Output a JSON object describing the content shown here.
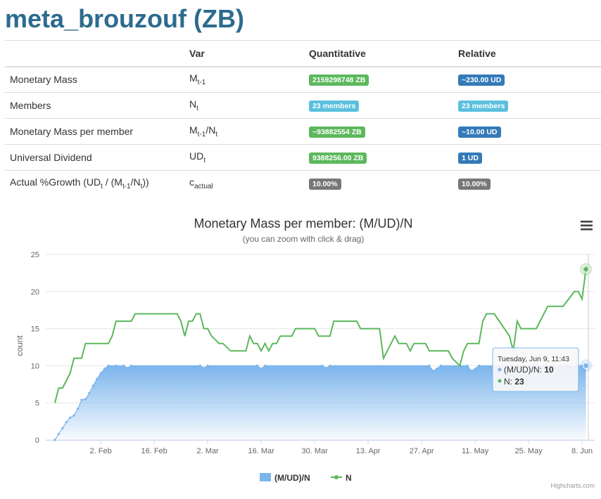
{
  "page_title": "meta_brouzouf (ZB)",
  "table": {
    "headers": [
      "",
      "Var",
      "Quantitative",
      "Relative"
    ],
    "rows": [
      {
        "label": "Monetary Mass",
        "var_base": "M",
        "var_sub": "t-1",
        "var_mid": "",
        "var_sub2": "",
        "quant": "2159298748 ZB",
        "quant_color": "#5cb85c",
        "rel": "~230.00 UD",
        "rel_color": "#337ab7"
      },
      {
        "label": "Members",
        "var_base": "N",
        "var_sub": "t",
        "var_mid": "",
        "var_sub2": "",
        "quant": "23 members",
        "quant_color": "#5bc0de",
        "rel": "23 members",
        "rel_color": "#5bc0de"
      },
      {
        "label": "Monetary Mass per member",
        "var_base": "M",
        "var_sub": "t-1",
        "var_mid": "/N",
        "var_sub2": "t",
        "quant": "~93882554 ZB",
        "quant_color": "#5cb85c",
        "rel": "~10.00 UD",
        "rel_color": "#337ab7"
      },
      {
        "label": "Universal Dividend",
        "var_base": "UD",
        "var_sub": "t",
        "var_mid": "",
        "var_sub2": "",
        "quant": "9388256.00 ZB",
        "quant_color": "#5cb85c",
        "rel": "1 UD",
        "rel_color": "#337ab7"
      },
      {
        "label_parts": [
          "Actual %Growth (UD",
          "t",
          " / (M",
          "t-1",
          "/N",
          "t",
          "))"
        ],
        "var_base": "c",
        "var_sub": "actual",
        "var_mid": "",
        "var_sub2": "",
        "quant": "10.00%",
        "quant_color": "#777777",
        "rel": "10.00%",
        "rel_color": "#777777"
      }
    ]
  },
  "chart_data": {
    "type": "area",
    "title": "Monetary Mass per member: (M/UD)/N",
    "subtitle": "(you can zoom with click & drag)",
    "ylabel": "count",
    "xlabel": "",
    "ylim": [
      0,
      25
    ],
    "yticks": [
      "0",
      "5",
      "10",
      "15",
      "20",
      "25"
    ],
    "xlim": [
      "2015-01-21",
      "2015-06-10"
    ],
    "xticks": [
      {
        "date": "2015-02-02",
        "label": "2. Feb"
      },
      {
        "date": "2015-02-16",
        "label": "16. Feb"
      },
      {
        "date": "2015-03-02",
        "label": "2. Mar"
      },
      {
        "date": "2015-03-16",
        "label": "16. Mar"
      },
      {
        "date": "2015-03-30",
        "label": "30. Mar"
      },
      {
        "date": "2015-04-13",
        "label": "13. Apr"
      },
      {
        "date": "2015-04-27",
        "label": "27. Apr"
      },
      {
        "date": "2015-05-11",
        "label": "11. May"
      },
      {
        "date": "2015-05-25",
        "label": "25. May"
      },
      {
        "date": "2015-06-08",
        "label": "8. Jun"
      }
    ],
    "grid": true,
    "legend_position": "bottom-center",
    "series": [
      {
        "name": "(M/UD)/N",
        "color": "#7cb5ec",
        "kind": "area",
        "points": [
          [
            "2015-01-21",
            0
          ],
          [
            "2015-01-22",
            0.8
          ],
          [
            "2015-01-23",
            1.6
          ],
          [
            "2015-01-24",
            2.4
          ],
          [
            "2015-01-25",
            3.0
          ],
          [
            "2015-01-26",
            3.3
          ],
          [
            "2015-01-27",
            4.2
          ],
          [
            "2015-01-28",
            5.4
          ],
          [
            "2015-01-29",
            5.5
          ],
          [
            "2015-01-30",
            6.3
          ],
          [
            "2015-01-31",
            7.3
          ],
          [
            "2015-02-01",
            8.2
          ],
          [
            "2015-02-02",
            9.0
          ],
          [
            "2015-02-03",
            9.6
          ],
          [
            "2015-02-04",
            10
          ],
          [
            "2015-02-06",
            10
          ],
          [
            "2015-02-08",
            10
          ],
          [
            "2015-02-09",
            9.7
          ],
          [
            "2015-02-10",
            10
          ],
          [
            "2015-02-28",
            10
          ],
          [
            "2015-03-01",
            9.7
          ],
          [
            "2015-03-02",
            10
          ],
          [
            "2015-03-15",
            10
          ],
          [
            "2015-03-16",
            9.6
          ],
          [
            "2015-03-17",
            10
          ],
          [
            "2015-04-01",
            10
          ],
          [
            "2015-04-02",
            9.7
          ],
          [
            "2015-04-03",
            10
          ],
          [
            "2015-04-29",
            10
          ],
          [
            "2015-04-30",
            9.3
          ],
          [
            "2015-05-01",
            9.6
          ],
          [
            "2015-05-02",
            10
          ],
          [
            "2015-05-09",
            10
          ],
          [
            "2015-05-10",
            9.3
          ],
          [
            "2015-05-11",
            9.6
          ],
          [
            "2015-05-12",
            10
          ],
          [
            "2015-06-08",
            10
          ],
          [
            "2015-06-09",
            10
          ]
        ]
      },
      {
        "name": "N",
        "color": "#5cb85c",
        "kind": "line",
        "points": [
          [
            "2015-01-21",
            5
          ],
          [
            "2015-01-22",
            7
          ],
          [
            "2015-01-23",
            7
          ],
          [
            "2015-01-25",
            9
          ],
          [
            "2015-01-26",
            11
          ],
          [
            "2015-01-28",
            11
          ],
          [
            "2015-01-29",
            13
          ],
          [
            "2015-02-04",
            13
          ],
          [
            "2015-02-05",
            14
          ],
          [
            "2015-02-06",
            16
          ],
          [
            "2015-02-10",
            16
          ],
          [
            "2015-02-11",
            17
          ],
          [
            "2015-02-22",
            17
          ],
          [
            "2015-02-23",
            16
          ],
          [
            "2015-02-24",
            14
          ],
          [
            "2015-02-25",
            16
          ],
          [
            "2015-02-26",
            16
          ],
          [
            "2015-02-27",
            17
          ],
          [
            "2015-02-28",
            17
          ],
          [
            "2015-03-01",
            15
          ],
          [
            "2015-03-02",
            15
          ],
          [
            "2015-03-03",
            14
          ],
          [
            "2015-03-05",
            13
          ],
          [
            "2015-03-06",
            13
          ],
          [
            "2015-03-08",
            12
          ],
          [
            "2015-03-12",
            12
          ],
          [
            "2015-03-13",
            14
          ],
          [
            "2015-03-14",
            13
          ],
          [
            "2015-03-15",
            13
          ],
          [
            "2015-03-16",
            12
          ],
          [
            "2015-03-17",
            13
          ],
          [
            "2015-03-18",
            12
          ],
          [
            "2015-03-19",
            13
          ],
          [
            "2015-03-20",
            13
          ],
          [
            "2015-03-21",
            14
          ],
          [
            "2015-03-24",
            14
          ],
          [
            "2015-03-25",
            15
          ],
          [
            "2015-03-30",
            15
          ],
          [
            "2015-03-31",
            14
          ],
          [
            "2015-04-03",
            14
          ],
          [
            "2015-04-04",
            16
          ],
          [
            "2015-04-10",
            16
          ],
          [
            "2015-04-11",
            15
          ],
          [
            "2015-04-16",
            15
          ],
          [
            "2015-04-17",
            11
          ],
          [
            "2015-04-20",
            14
          ],
          [
            "2015-04-21",
            13
          ],
          [
            "2015-04-23",
            13
          ],
          [
            "2015-04-24",
            12
          ],
          [
            "2015-04-25",
            13
          ],
          [
            "2015-04-28",
            13
          ],
          [
            "2015-04-29",
            12
          ],
          [
            "2015-05-04",
            12
          ],
          [
            "2015-05-05",
            11
          ],
          [
            "2015-05-07",
            10
          ],
          [
            "2015-05-08",
            12
          ],
          [
            "2015-05-09",
            13
          ],
          [
            "2015-05-12",
            13
          ],
          [
            "2015-05-13",
            16
          ],
          [
            "2015-05-14",
            17
          ],
          [
            "2015-05-16",
            17
          ],
          [
            "2015-05-20",
            14
          ],
          [
            "2015-05-21",
            12
          ],
          [
            "2015-05-22",
            16
          ],
          [
            "2015-05-23",
            15
          ],
          [
            "2015-05-27",
            15
          ],
          [
            "2015-05-30",
            18
          ],
          [
            "2015-06-03",
            18
          ],
          [
            "2015-06-06",
            20
          ],
          [
            "2015-06-07",
            20
          ],
          [
            "2015-06-08",
            19
          ],
          [
            "2015-06-09",
            23
          ]
        ]
      }
    ]
  },
  "tooltip": {
    "header": "Tuesday, Jun 9, 11:43",
    "rows": [
      {
        "name": "(M/UD)/N",
        "value": "10"
      },
      {
        "name": "N",
        "value": "23"
      }
    ]
  },
  "menu_icon": "hamburger-menu-icon",
  "credits": "Highcharts.com"
}
